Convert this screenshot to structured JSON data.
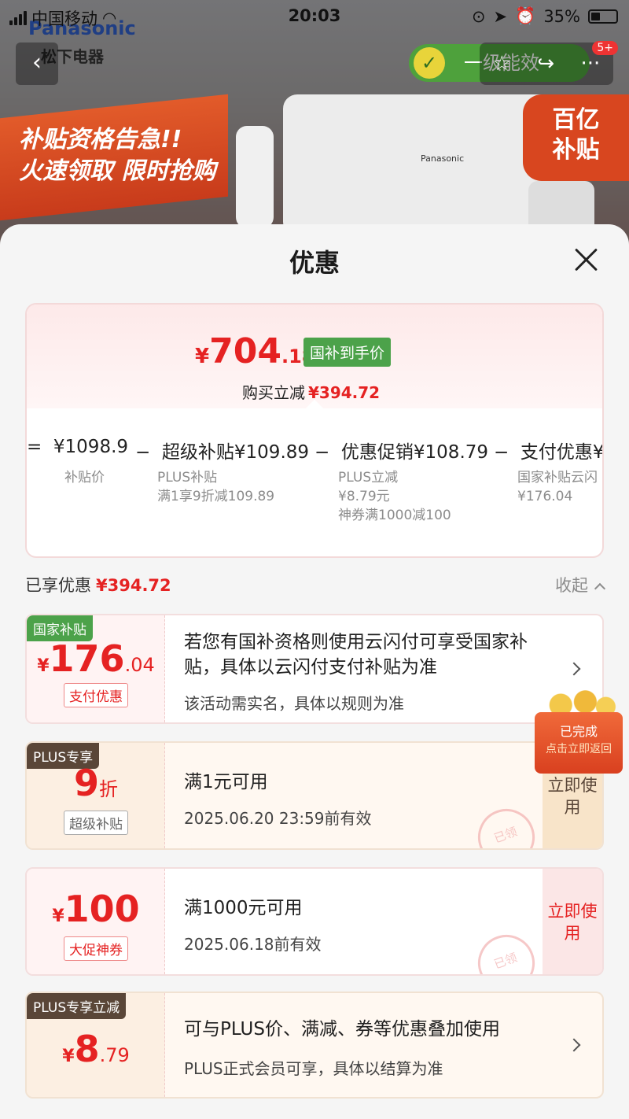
{
  "status_bar": {
    "carrier": "中国移动",
    "time": "20:03",
    "battery": "35%"
  },
  "background": {
    "brand": "Panasonic",
    "brand_cn": "松下电器",
    "energy_label": "一级能效",
    "notif_count": "5+",
    "promo_line1": "补贴资格告急!!",
    "promo_line2": "火速领取 限时抢购",
    "billion_line1": "百亿",
    "billion_line2": "补贴",
    "product_brand": "Panasonic"
  },
  "sheet": {
    "title": "优惠",
    "summary": {
      "currency": "¥",
      "price_int": "704",
      "price_dec": ".18",
      "tag": "国补到手价",
      "reduce_label": "购买立减",
      "reduce_amount": "¥394.72",
      "breakdown": [
        {
          "op": "=",
          "label": "",
          "value": "¥1098.9",
          "sub": [
            "补贴价"
          ]
        },
        {
          "op": "−",
          "label": "超级补贴",
          "value": "¥109.89",
          "sub": [
            "PLUS补贴",
            "满1享9折减109.89"
          ]
        },
        {
          "op": "−",
          "label": "优惠促销",
          "value": "¥108.79",
          "sub": [
            "PLUS立减",
            "¥8.79元",
            "神券满1000减100"
          ]
        },
        {
          "op": "−",
          "label": "支付优惠",
          "value": "¥",
          "sub": [
            "国家补贴云闪",
            "¥176.04"
          ]
        }
      ]
    },
    "enjoyed_label": "已享优惠",
    "enjoyed_amount": "¥394.72",
    "collapse_label": "收起",
    "coupons": [
      {
        "tag": "国家补贴",
        "currency": "¥",
        "amount_int": "176",
        "amount_dec": ".04",
        "sub_label": "支付优惠",
        "main": "若您有国补资格则使用云闪付可享受国家补贴，具体以云闪付支付补贴为准",
        "desc": "该活动需实名，具体以规则为准"
      },
      {
        "tag": "PLUS专享",
        "amount_int": "9",
        "amount_unit": "折",
        "sub_label": "超级补贴",
        "main": "满1元可用",
        "desc": "2025.06.20 23:59前有效",
        "button": "立即使用",
        "stamp": "已领"
      },
      {
        "currency": "¥",
        "amount_int": "100",
        "sub_label": "大促神券",
        "main": "满1000元可用",
        "desc": "2025.06.18前有效",
        "button": "立即使用",
        "stamp": "已领"
      },
      {
        "tag": "PLUS专享立减",
        "currency": "¥",
        "amount_int": "8",
        "amount_dec": ".79",
        "main": "可与PLUS价、满减、券等优惠叠加使用",
        "desc": "PLUS正式会员可享，具体以结算为准"
      }
    ],
    "reward": {
      "line1": "已完成",
      "line2": "点击立即返回"
    }
  },
  "colors": {
    "accent_red": "#e52222",
    "gov_green": "#4ca24a",
    "plus_dark": "#5a4638"
  }
}
